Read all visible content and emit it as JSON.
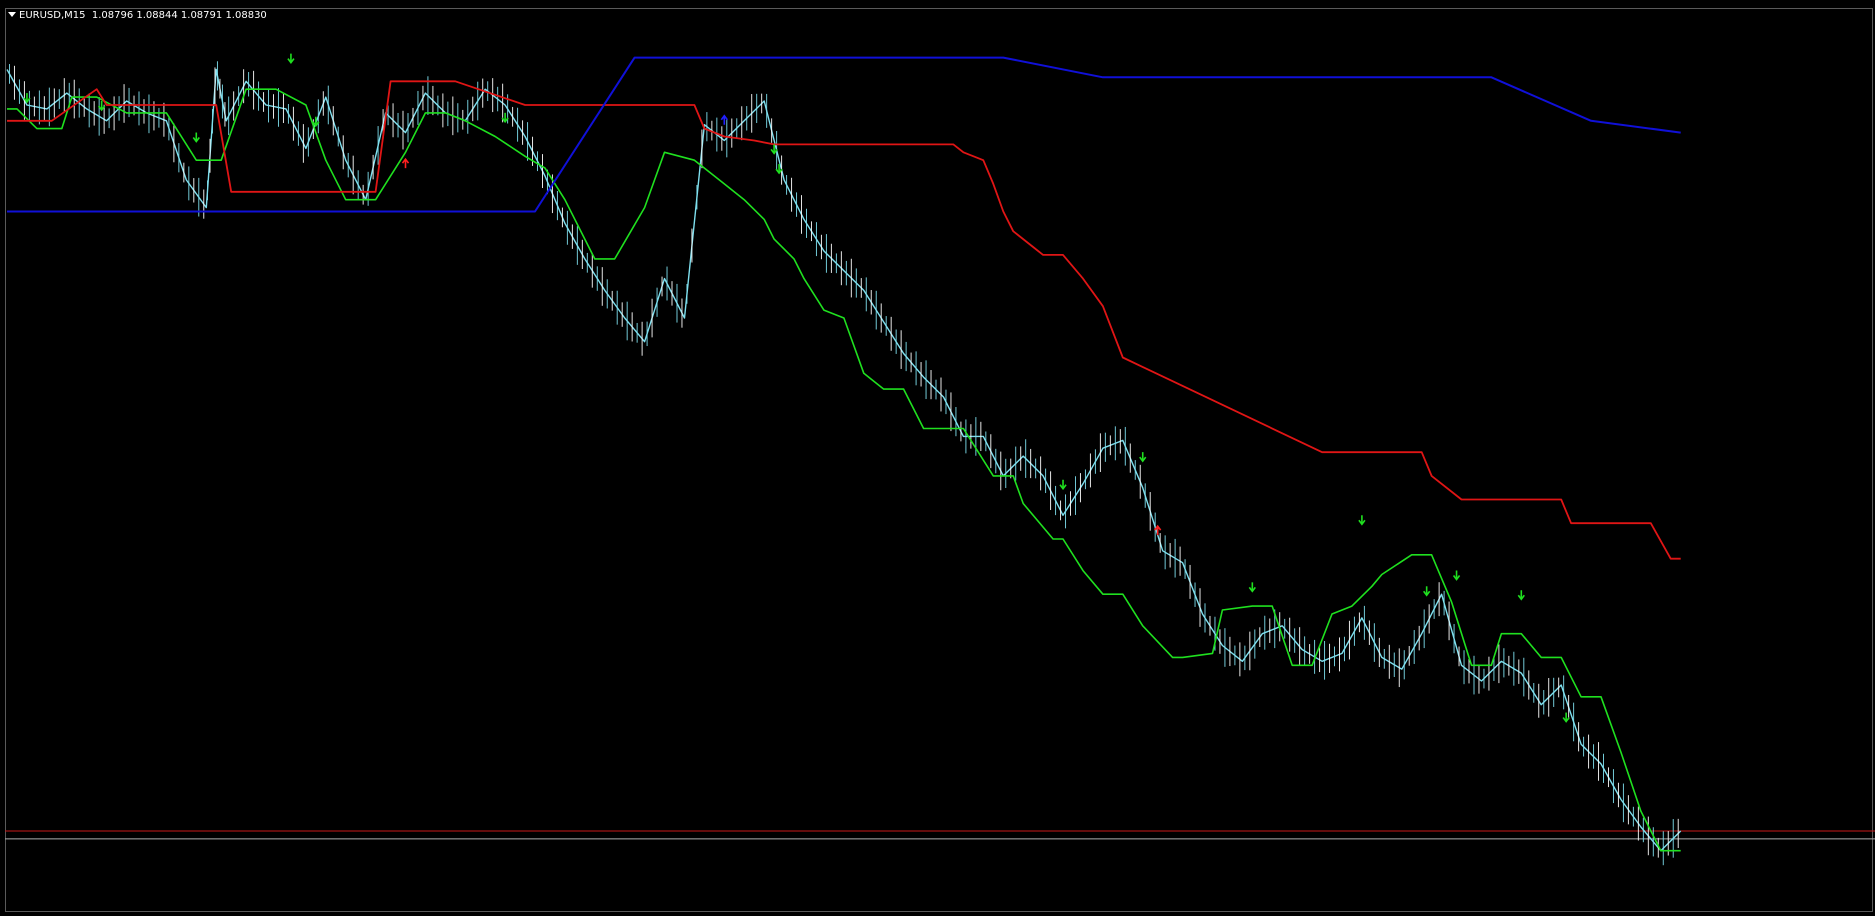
{
  "window": {
    "symbol": "EURUSD,M15",
    "ohlc": "1.08796 1.08844 1.08791 1.08830"
  },
  "colors": {
    "background": "#000000",
    "frame": "#5a5a5a",
    "price_line": "#7fe0ef",
    "price_wick": "#ffffff",
    "green_line": "#1fe01f",
    "red_line": "#e01515",
    "blue_line": "#1010d8",
    "bid_line": "#c81a1a",
    "ask_line": "#b0b0b0",
    "up_arrow": "#1fe01f",
    "down_arrow_blue": "#2020ff",
    "down_arrow_red": "#ff2020"
  },
  "chart_data": {
    "type": "line",
    "series": [
      {
        "role": "price",
        "x": [
          0,
          20,
          40,
          60,
          80,
          100,
          120,
          140,
          160,
          180,
          200,
          210,
          220,
          240,
          260,
          280,
          300,
          320,
          340,
          360,
          380,
          400,
          420,
          440,
          460,
          480,
          500,
          520,
          540,
          560,
          580,
          600,
          620,
          640,
          660,
          680,
          700,
          720,
          740,
          760,
          780,
          800,
          820,
          840,
          860,
          880,
          900,
          920,
          940,
          960,
          980,
          1000,
          1020,
          1040,
          1060,
          1080,
          1100,
          1120,
          1140,
          1160,
          1180,
          1200,
          1220,
          1240,
          1260,
          1280,
          1300,
          1320,
          1340,
          1360,
          1380,
          1400,
          1420,
          1440,
          1460,
          1480,
          1500,
          1520,
          1540,
          1560,
          1580,
          1600,
          1620,
          1640,
          1660,
          1680
        ],
        "y": [
          0.93,
          0.84,
          0.83,
          0.87,
          0.83,
          0.8,
          0.85,
          0.82,
          0.8,
          0.65,
          0.58,
          0.93,
          0.8,
          0.9,
          0.84,
          0.83,
          0.73,
          0.86,
          0.7,
          0.6,
          0.82,
          0.77,
          0.87,
          0.82,
          0.8,
          0.88,
          0.84,
          0.76,
          0.66,
          0.54,
          0.45,
          0.37,
          0.3,
          0.24,
          0.4,
          0.3,
          0.79,
          0.75,
          0.8,
          0.85,
          0.65,
          0.55,
          0.47,
          0.42,
          0.37,
          0.29,
          0.21,
          0.15,
          0.1,
          0.0,
          0.0,
          -0.1,
          -0.05,
          -0.1,
          -0.2,
          -0.12,
          -0.03,
          -0.01,
          -0.13,
          -0.29,
          -0.32,
          -0.45,
          -0.53,
          -0.57,
          -0.5,
          -0.48,
          -0.54,
          -0.57,
          -0.55,
          -0.46,
          -0.56,
          -0.59,
          -0.5,
          -0.4,
          -0.58,
          -0.62,
          -0.57,
          -0.6,
          -0.68,
          -0.63,
          -0.78,
          -0.83,
          -0.92,
          -0.99,
          -1.05,
          -1.0
        ]
      },
      {
        "role": "green-channel",
        "x": [
          0,
          10,
          30,
          55,
          65,
          90,
          120,
          160,
          190,
          215,
          240,
          255,
          270,
          300,
          320,
          340,
          370,
          400,
          420,
          440,
          460,
          490,
          520,
          540,
          560,
          590,
          610,
          640,
          660,
          690,
          700,
          720,
          740,
          760,
          770,
          790,
          800,
          820,
          840,
          860,
          880,
          900,
          920,
          960,
          990,
          1010,
          1020,
          1050,
          1060,
          1080,
          1100,
          1120,
          1140,
          1170,
          1180,
          1210,
          1220,
          1250,
          1270,
          1290,
          1310,
          1330,
          1350,
          1370,
          1380,
          1410,
          1430,
          1450,
          1470,
          1490,
          1500,
          1520,
          1540,
          1560,
          1580,
          1600,
          1620,
          1640,
          1660,
          1680
        ],
        "y": [
          0.83,
          0.83,
          0.78,
          0.78,
          0.86,
          0.86,
          0.82,
          0.82,
          0.7,
          0.7,
          0.88,
          0.88,
          0.88,
          0.84,
          0.7,
          0.6,
          0.6,
          0.72,
          0.82,
          0.82,
          0.8,
          0.76,
          0.71,
          0.68,
          0.6,
          0.45,
          0.45,
          0.58,
          0.72,
          0.7,
          0.68,
          0.64,
          0.6,
          0.55,
          0.5,
          0.45,
          0.4,
          0.32,
          0.3,
          0.16,
          0.12,
          0.12,
          0.02,
          0.02,
          -0.1,
          -0.1,
          -0.17,
          -0.26,
          -0.26,
          -0.34,
          -0.4,
          -0.4,
          -0.48,
          -0.56,
          -0.56,
          -0.55,
          -0.44,
          -0.43,
          -0.43,
          -0.58,
          -0.58,
          -0.45,
          -0.43,
          -0.38,
          -0.35,
          -0.3,
          -0.3,
          -0.42,
          -0.58,
          -0.58,
          -0.5,
          -0.5,
          -0.56,
          -0.56,
          -0.66,
          -0.66,
          -0.8,
          -0.95,
          -1.05,
          -1.05
        ]
      },
      {
        "role": "red-channel",
        "x": [
          0,
          45,
          90,
          100,
          210,
          225,
          370,
          385,
          450,
          520,
          690,
          700,
          720,
          750,
          770,
          790,
          950,
          960,
          980,
          990,
          1000,
          1010,
          1030,
          1040,
          1060,
          1080,
          1100,
          1120,
          1320,
          1330,
          1340,
          1350,
          1360,
          1380,
          1400,
          1420,
          1430,
          1460,
          1560,
          1570,
          1650,
          1670,
          1680
        ],
        "y": [
          0.8,
          0.8,
          0.88,
          0.84,
          0.84,
          0.62,
          0.62,
          0.9,
          0.9,
          0.84,
          0.84,
          0.78,
          0.76,
          0.75,
          0.74,
          0.74,
          0.74,
          0.72,
          0.7,
          0.64,
          0.57,
          0.52,
          0.48,
          0.46,
          0.46,
          0.4,
          0.33,
          0.2,
          -0.04,
          -0.04,
          -0.04,
          -0.04,
          -0.04,
          -0.04,
          -0.04,
          -0.04,
          -0.1,
          -0.16,
          -0.16,
          -0.22,
          -0.22,
          -0.31,
          -0.31
        ]
      },
      {
        "role": "blue-line",
        "x": [
          0,
          180,
          450,
          530,
          630,
          690,
          800,
          1000,
          1100,
          1300,
          1400,
          1490,
          1590,
          1680
        ],
        "y": [
          0.57,
          0.57,
          0.57,
          0.57,
          0.96,
          0.96,
          0.96,
          0.96,
          0.91,
          0.91,
          0.91,
          0.91,
          0.8,
          0.77
        ]
      }
    ],
    "markers": [
      {
        "kind": "up",
        "color": "green",
        "x": 20,
        "y": 0.86
      },
      {
        "kind": "up",
        "color": "green",
        "x": 95,
        "y": 0.84
      },
      {
        "kind": "up",
        "color": "green",
        "x": 190,
        "y": 0.76
      },
      {
        "kind": "up",
        "color": "green",
        "x": 285,
        "y": 0.96
      },
      {
        "kind": "up",
        "color": "green",
        "x": 310,
        "y": 0.8
      },
      {
        "kind": "down",
        "color": "red",
        "x": 400,
        "y": 0.69
      },
      {
        "kind": "up",
        "color": "green",
        "x": 500,
        "y": 0.81
      },
      {
        "kind": "down",
        "color": "blue",
        "x": 720,
        "y": 0.8
      },
      {
        "kind": "up",
        "color": "green",
        "x": 770,
        "y": 0.73
      },
      {
        "kind": "up",
        "color": "green",
        "x": 775,
        "y": 0.68
      },
      {
        "kind": "up",
        "color": "green",
        "x": 1060,
        "y": -0.12
      },
      {
        "kind": "up",
        "color": "green",
        "x": 1140,
        "y": -0.05
      },
      {
        "kind": "down",
        "color": "red",
        "x": 1155,
        "y": -0.24
      },
      {
        "kind": "up",
        "color": "green",
        "x": 1250,
        "y": -0.38
      },
      {
        "kind": "up",
        "color": "green",
        "x": 1360,
        "y": -0.21
      },
      {
        "kind": "up",
        "color": "green",
        "x": 1425,
        "y": -0.39
      },
      {
        "kind": "up",
        "color": "green",
        "x": 1455,
        "y": -0.35
      },
      {
        "kind": "up",
        "color": "green",
        "x": 1520,
        "y": -0.4
      },
      {
        "kind": "up",
        "color": "green",
        "x": 1565,
        "y": -0.71
      }
    ],
    "hlines": [
      {
        "role": "bid",
        "y": -1.0
      },
      {
        "role": "ask",
        "y": -1.02
      }
    ],
    "ylim": [
      -1.18,
      1.03
    ],
    "xlim": [
      0,
      1870
    ],
    "grid": false
  }
}
